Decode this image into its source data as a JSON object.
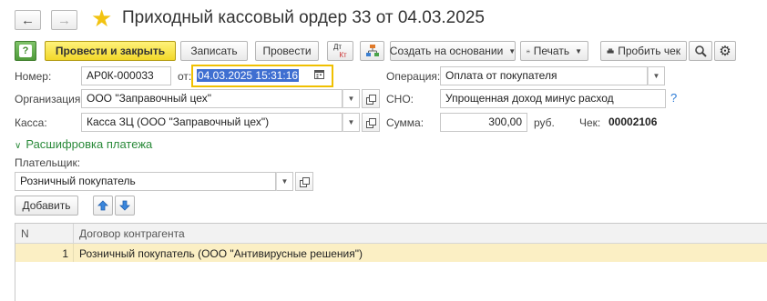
{
  "window": {
    "title": "Приходный кассовый ордер 33 от 04.03.2025"
  },
  "nav": {
    "back_glyph": "←",
    "forward_glyph": "→",
    "favorite_glyph": "★"
  },
  "toolbar": {
    "help_glyph": "?",
    "post_close": "Провести и закрыть",
    "save": "Записать",
    "post": "Провести",
    "dt_label": "Дт",
    "kt_label": "Кт",
    "create_based": "Создать на основании",
    "print": "Печать",
    "receipt": "Пробить чек",
    "search_glyph": "⌕",
    "settings_glyph": "⚙"
  },
  "form": {
    "number_label": "Номер:",
    "number_value": "АР0К-000033",
    "date_from_label": "от:",
    "date_value": "04.03.2025 15:31:16",
    "operation_label": "Операция:",
    "operation_value": "Оплата от покупателя",
    "org_label": "Организация:",
    "org_value": "ООО \"Заправочный цех\"",
    "sno_label": "СНО:",
    "sno_value": "Упрощенная доход минус расход",
    "sno_help": "?",
    "kassa_label": "Касса:",
    "kassa_value": "Касса ЗЦ (ООО \"Заправочный цех\")",
    "sum_label": "Сумма:",
    "sum_value": "300,00",
    "currency": "руб.",
    "check_label": "Чек:",
    "check_value": "00002106"
  },
  "payment": {
    "section_title": "Расшифровка платежа",
    "payer_label": "Плательщик:",
    "payer_value": "Розничный покупатель",
    "add_button": "Добавить",
    "up_glyph": "🡅",
    "down_glyph": "🡇"
  },
  "table": {
    "columns": [
      "N",
      "Договор контрагента"
    ],
    "rows": [
      {
        "n": "1",
        "contract": "Розничный покупатель (ООО \"Антивирусные решения\")"
      }
    ]
  },
  "colors": {
    "primary_button": "#f2d82a",
    "selected_row": "#fbefc4",
    "date_focus_border": "#f0c000",
    "section_green": "#2a8a3a",
    "help_blue": "#2c7bd6"
  }
}
